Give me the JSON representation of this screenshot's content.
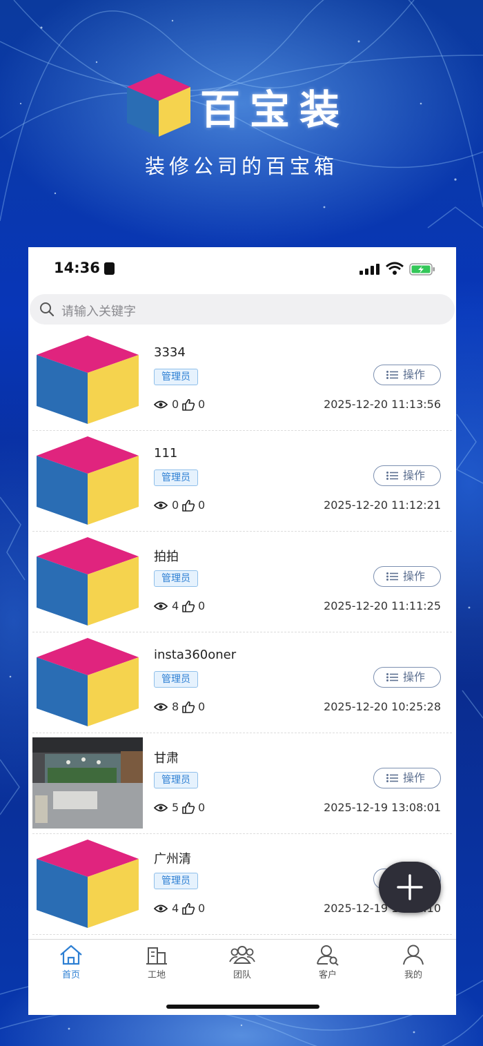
{
  "colors": {
    "accent": "#2d7fd3",
    "cube_top": "#e0247e",
    "cube_left": "#2a6db4",
    "cube_right": "#f5d34e",
    "fab": "#2e2e38"
  },
  "brand": {
    "name": "百宝装",
    "slogan": "装修公司的百宝箱"
  },
  "status_bar": {
    "time": "14:36"
  },
  "search": {
    "placeholder": "请输入关键字",
    "icon": "search-icon"
  },
  "items": [
    {
      "title": "3334",
      "badge": "管理员",
      "action": "操作",
      "views": "0",
      "likes": "0",
      "date": "2025-12-20 11:13:56",
      "thumb": "cube-logo"
    },
    {
      "title": "111",
      "badge": "管理员",
      "action": "操作",
      "views": "0",
      "likes": "0",
      "date": "2025-12-20 11:12:21",
      "thumb": "cube-logo"
    },
    {
      "title": "拍拍",
      "badge": "管理员",
      "action": "操作",
      "views": "4",
      "likes": "0",
      "date": "2025-12-20 11:11:25",
      "thumb": "cube-logo"
    },
    {
      "title": "insta360oner",
      "badge": "管理员",
      "action": "操作",
      "views": "8",
      "likes": "0",
      "date": "2025-12-20 10:25:28",
      "thumb": "cube-logo"
    },
    {
      "title": "甘肃",
      "badge": "管理员",
      "action": "操作",
      "views": "5",
      "likes": "0",
      "date": "2025-12-19 13:08:01",
      "thumb": "office-photo"
    },
    {
      "title": "广州清",
      "badge": "管理员",
      "action": "操作",
      "views": "4",
      "likes": "0",
      "date": "2025-12-19 11:31:10",
      "thumb": "cube-logo"
    }
  ],
  "tabs": [
    {
      "label": "首页",
      "icon": "home-icon",
      "active": true
    },
    {
      "label": "工地",
      "icon": "building-icon",
      "active": false
    },
    {
      "label": "团队",
      "icon": "team-icon",
      "active": false
    },
    {
      "label": "客户",
      "icon": "customer-search-icon",
      "active": false
    },
    {
      "label": "我的",
      "icon": "user-icon",
      "active": false
    }
  ]
}
